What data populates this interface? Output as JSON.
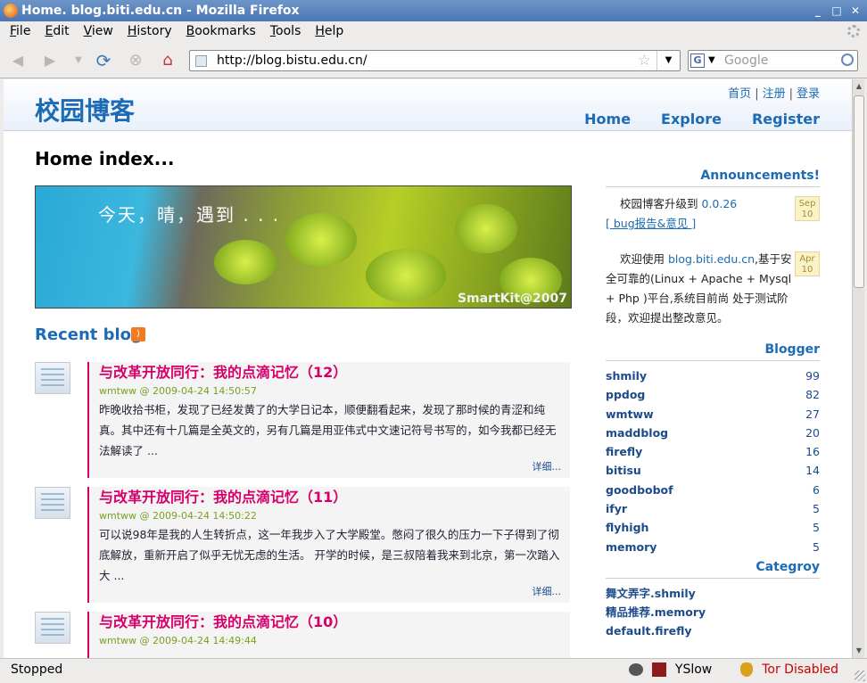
{
  "window": {
    "title": "Home. blog.biti.edu.cn - Mozilla Firefox"
  },
  "menu": [
    "File",
    "Edit",
    "View",
    "History",
    "Bookmarks",
    "Tools",
    "Help"
  ],
  "toolbar": {
    "url": "http://blog.bistu.edu.cn/",
    "search_placeholder": "Google",
    "search_engine_letter": "G"
  },
  "site": {
    "logo": "校园博客",
    "top_links": [
      "首页",
      "注册",
      "登录"
    ],
    "nav": [
      "Home",
      "Explore",
      "Register"
    ],
    "heading": "Home index...",
    "banner_text": "今天，晴，遇到 . . .",
    "banner_watermark": "SmartKit@2007",
    "recent_title": "Recent blog"
  },
  "posts": [
    {
      "title": "与改革开放同行：我的点滴记忆（12）",
      "meta": "wmtww @ 2009-04-24 14:50:57",
      "excerpt": "昨晚收拾书柜，发现了已经发黄了的大学日记本，顺便翻看起来，发现了那时候的青涩和纯真。其中还有十几篇是全英文的，另有几篇是用亚伟式中文速记符号书写的，如今我都已经无法解读了 ...",
      "more": "详细..."
    },
    {
      "title": "与改革开放同行：我的点滴记忆（11）",
      "meta": "wmtww @ 2009-04-24 14:50:22",
      "excerpt": "可以说98年是我的人生转折点，这一年我步入了大学殿堂。憋闷了很久的压力一下子得到了彻底解放，重新开启了似乎无忧无虑的生活。 开学的时候，是三叔陪着我来到北京，第一次踏入大 ...",
      "more": "详细..."
    },
    {
      "title": "与改革开放同行：我的点滴记忆（10）",
      "meta": "wmtww @ 2009-04-24 14:49:44",
      "excerpt": "",
      "more": ""
    }
  ],
  "sidebar": {
    "announcements_title": "Announcements!",
    "announcements": [
      {
        "text": "校园博客升级到",
        "link": "0.0.26",
        "extra": "[ bug报告&意见 ]",
        "date_month": "Sep",
        "date_day": "10"
      },
      {
        "text": "欢迎使用",
        "link": "blog.biti.edu.cn",
        "extra": ",基于安全可靠的(Linux + Apache + Mysql + Php )平台,系统目前尚 处于测试阶段，欢迎提出整改意见。",
        "date_month": "Apr",
        "date_day": "10"
      }
    ],
    "blogger_title": "Blogger",
    "bloggers": [
      {
        "name": "shmily",
        "count": "99"
      },
      {
        "name": "ppdog",
        "count": "82"
      },
      {
        "name": "wmtww",
        "count": "27"
      },
      {
        "name": "maddblog",
        "count": "20"
      },
      {
        "name": "firefly",
        "count": "16"
      },
      {
        "name": "bitisu",
        "count": "14"
      },
      {
        "name": "goodbobof",
        "count": "6"
      },
      {
        "name": "ifyr",
        "count": "5"
      },
      {
        "name": "flyhigh",
        "count": "5"
      },
      {
        "name": "memory",
        "count": "5"
      }
    ],
    "category_title": "Categroy",
    "categories": [
      "舞文弄字.shmily",
      "精品推荐.memory",
      "default.firefly"
    ]
  },
  "status": {
    "text": "Stopped",
    "yslow": "YSlow",
    "tor": "Tor Disabled"
  },
  "colors": {
    "link": "#1c6bb4",
    "post_title": "#d6006b",
    "meta": "#7aa021",
    "titlebar": "#4a76b3"
  }
}
